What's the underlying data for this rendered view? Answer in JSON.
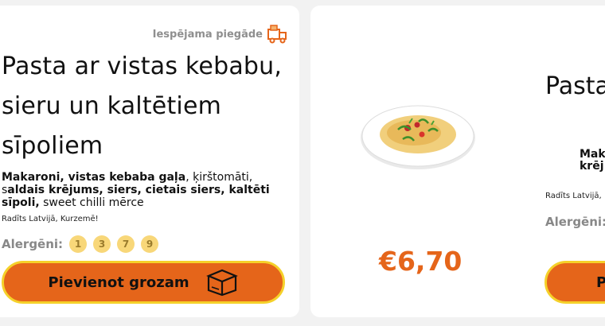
{
  "card1": {
    "delivery_label": "Iespējama piegāde",
    "title": "Pasta ar vistas kebabu, sieru un kaltētiem sīpoliem",
    "description_parts": [
      "Makaroni, vistas kebaba gaļa",
      ", ķirštomāti, s",
      "aldais krējums, siers, cietais siers, kaltēti sīpoli,",
      " sweet chilli mērce"
    ],
    "origin": "Radīts Latvijā, Kurzemē!",
    "allergens_label": "Alergēni:",
    "allergens": [
      "1",
      "3",
      "7",
      "9"
    ],
    "cart_button_label": "Pievienot grozam"
  },
  "card2": {
    "price": "€6,70",
    "title_partial": "Pasta",
    "description_partial_line1": "Mak",
    "description_partial_line2": "krēj",
    "origin_partial": "Radīts Latvijā,",
    "allergens_label_partial": "Alergēni:",
    "cart_button_partial": "P"
  },
  "colors": {
    "accent": "#e5651a",
    "button_border": "#f5d12a",
    "allergen_pill": "#f8d779",
    "muted_text": "#8f8f8f"
  }
}
